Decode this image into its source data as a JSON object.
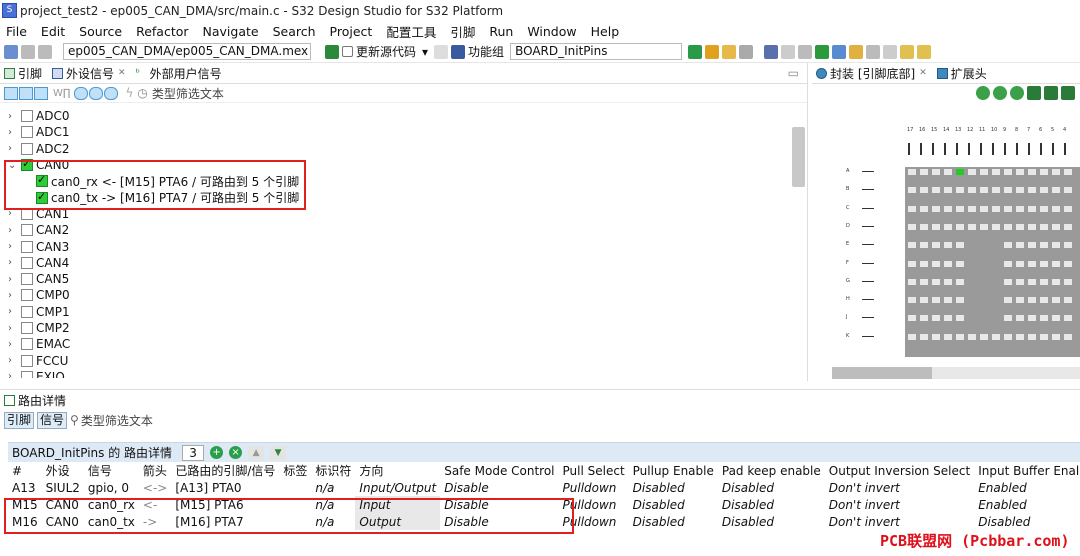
{
  "window": {
    "title": "project_test2 - ep005_CAN_DMA/src/main.c - S32 Design Studio for S32 Platform"
  },
  "menu": [
    "File",
    "Edit",
    "Source",
    "Refactor",
    "Navigate",
    "Search",
    "Project",
    "配置工具",
    "引脚",
    "Run",
    "Window",
    "Help"
  ],
  "toolbar": {
    "mex_path": "ep005_CAN_DMA/ep005_CAN_DMA.mex",
    "update_code": "更新源代码",
    "function_group_label": "功能组",
    "function_group_value": "BOARD_InitPins"
  },
  "left_tabs": [
    {
      "label": "引脚"
    },
    {
      "label": "外设信号"
    },
    {
      "label": "外部用户信号"
    }
  ],
  "filter": {
    "placeholder": "类型筛选文本"
  },
  "tree": [
    {
      "label": "ADC0",
      "checked": false,
      "expanded": false
    },
    {
      "label": "ADC1",
      "checked": false,
      "expanded": false
    },
    {
      "label": "ADC2",
      "checked": false,
      "expanded": false
    },
    {
      "label": "CAN0",
      "checked": true,
      "expanded": true
    },
    {
      "label": "can0_rx <- [M15] PTA6 / 可路由到 5 个引脚",
      "checked": true,
      "child": true
    },
    {
      "label": "can0_tx -> [M16] PTA7 / 可路由到 5 个引脚",
      "checked": true,
      "child": true
    },
    {
      "label": "CAN1",
      "checked": false
    },
    {
      "label": "CAN2",
      "checked": false
    },
    {
      "label": "CAN3",
      "checked": false
    },
    {
      "label": "CAN4",
      "checked": false
    },
    {
      "label": "CAN5",
      "checked": false
    },
    {
      "label": "CMP0",
      "checked": false
    },
    {
      "label": "CMP1",
      "checked": false
    },
    {
      "label": "CMP2",
      "checked": false
    },
    {
      "label": "EMAC",
      "checked": false
    },
    {
      "label": "FCCU",
      "checked": false
    },
    {
      "label": "EXIO",
      "checked": false
    }
  ],
  "right_tabs": [
    {
      "label": "封装 [引脚底部]"
    },
    {
      "label": "扩展头"
    }
  ],
  "package": {
    "col_labels": [
      "17",
      "16",
      "15",
      "14",
      "13",
      "12",
      "11",
      "10",
      "9",
      "8",
      "7",
      "6",
      "5",
      "4"
    ],
    "row_labels": [
      "A",
      "B",
      "C",
      "D",
      "E",
      "F",
      "G",
      "H",
      "J",
      "K"
    ]
  },
  "routing": {
    "title": "路由详情",
    "subtabs": [
      "引脚",
      "信号"
    ],
    "filter_placeholder": "类型筛选文本",
    "group_label": "BOARD_InitPins 的 路由详情",
    "count": "3",
    "headers": [
      "#",
      "外设",
      "信号",
      "箭头",
      "已路由的引脚/信号",
      "标签",
      "标识符",
      "方向",
      "Safe Mode Control",
      "Pull Select",
      "Pullup Enable",
      "Pad keep enable",
      "Output Inversion Select",
      "Input Buffer Enal"
    ],
    "rows": [
      [
        "A13",
        "SIUL2",
        "gpio, 0",
        "<->",
        "[A13] PTA0",
        "",
        "n/a",
        "Input/Output",
        "Disable",
        "Pulldown",
        "Disabled",
        "Disabled",
        "Don't invert",
        "Enabled"
      ],
      [
        "M15",
        "CAN0",
        "can0_rx",
        "<-",
        "[M15] PTA6",
        "",
        "n/a",
        "Input",
        "Disable",
        "Pulldown",
        "Disabled",
        "Disabled",
        "Don't invert",
        "Enabled"
      ],
      [
        "M16",
        "CAN0",
        "can0_tx",
        "->",
        "[M16] PTA7",
        "",
        "n/a",
        "Output",
        "Disable",
        "Pulldown",
        "Disabled",
        "Disabled",
        "Don't invert",
        "Disabled"
      ]
    ]
  },
  "watermark": "PCB联盟网 (Pcbbar.com)"
}
